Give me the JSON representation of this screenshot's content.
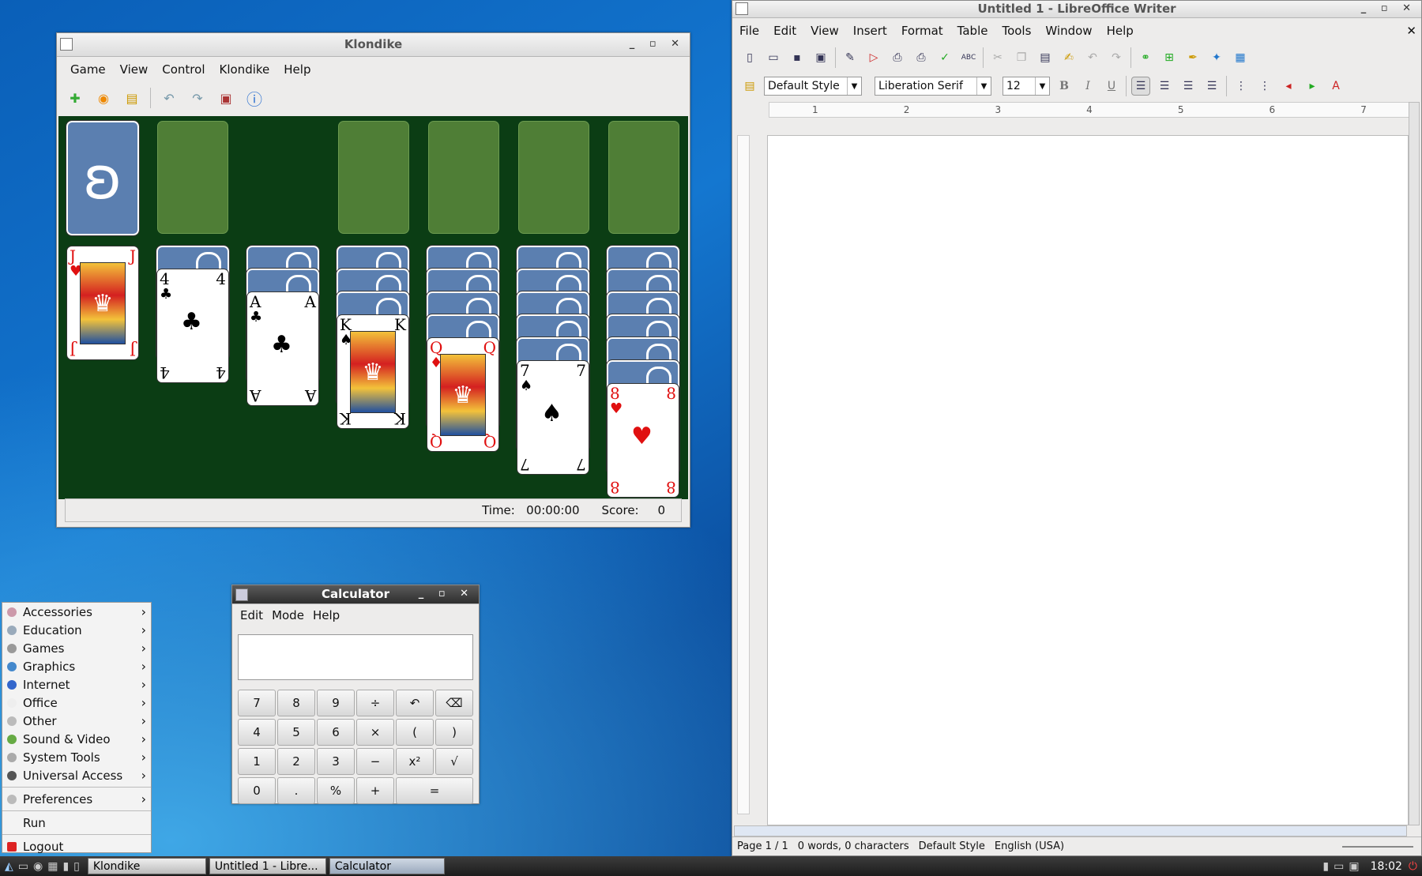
{
  "klondike": {
    "title": "Klondike",
    "menu": [
      "Game",
      "View",
      "Control",
      "Klondike",
      "Help"
    ],
    "status": {
      "time_label": "Time:",
      "time": "00:00:00",
      "score_label": "Score:",
      "score": "0"
    },
    "tableau": [
      {
        "rank": "J",
        "suit": "♥",
        "color": "red",
        "face": true
      },
      {
        "rank": "4",
        "suit": "♣",
        "color": "black",
        "face": false
      },
      {
        "rank": "A",
        "suit": "♣",
        "color": "black",
        "face": false
      },
      {
        "rank": "K",
        "suit": "♠",
        "color": "black",
        "face": true
      },
      {
        "rank": "Q",
        "suit": "♦",
        "color": "red",
        "face": true
      },
      {
        "rank": "7",
        "suit": "♠",
        "color": "black",
        "face": false
      },
      {
        "rank": "8",
        "suit": "♥",
        "color": "red",
        "face": false
      }
    ]
  },
  "calculator": {
    "title": "Calculator",
    "menu": [
      "Edit",
      "Mode",
      "Help"
    ],
    "display": "",
    "keys": [
      [
        "7",
        "8",
        "9",
        "÷",
        "↶",
        "⌫"
      ],
      [
        "4",
        "5",
        "6",
        "×",
        "(",
        ")"
      ],
      [
        "1",
        "2",
        "3",
        "−",
        "x²",
        "√"
      ],
      [
        "0",
        ".",
        "%",
        "+",
        "="
      ]
    ]
  },
  "writer": {
    "title": "Untitled 1 - LibreOffice Writer",
    "menu": [
      "File",
      "Edit",
      "View",
      "Insert",
      "Format",
      "Table",
      "Tools",
      "Window",
      "Help"
    ],
    "style": "Default Style",
    "font": "Liberation Serif",
    "size": "12",
    "ruler": [
      "1",
      "2",
      "3",
      "4",
      "5",
      "6",
      "7"
    ],
    "status": {
      "page": "Page 1 / 1",
      "words": "0 words, 0 characters",
      "style": "Default Style",
      "lang": "English (USA)"
    }
  },
  "appmenu": {
    "items": [
      "Accessories",
      "Education",
      "Games",
      "Graphics",
      "Internet",
      "Office",
      "Other",
      "Sound & Video",
      "System Tools",
      "Universal Access"
    ],
    "prefs": "Preferences",
    "run": "Run",
    "logout": "Logout"
  },
  "taskbar": {
    "tasks": [
      "Klondike",
      "Untitled 1 - Libre...",
      "Calculator"
    ],
    "clock": "18:02"
  }
}
